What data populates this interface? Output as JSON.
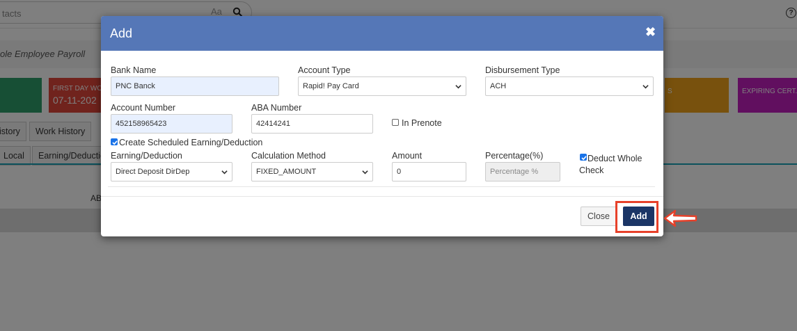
{
  "background": {
    "search": {
      "text": "tacts",
      "aa_label": "Aa"
    },
    "subheader": "ole Employee Payroll",
    "tiles": [
      {
        "label": "",
        "value": ""
      },
      {
        "label": "FIRST DAY WO",
        "value": "07-11-202"
      },
      {
        "label": "S",
        "value": ""
      },
      {
        "label": "EXPIRING CERT.",
        "value": ""
      }
    ],
    "tabs": [
      "istory",
      "Work History"
    ],
    "subtabs": [
      "Local",
      "Earning/Deductio"
    ],
    "column_label": "AB",
    "help": "?"
  },
  "modal": {
    "title": "Add",
    "close_symbol": "✖",
    "bank_name": {
      "label": "Bank Name",
      "value": "PNC Banck"
    },
    "account_type": {
      "label": "Account Type",
      "value": "Rapid! Pay Card"
    },
    "disbursement_type": {
      "label": "Disbursement Type",
      "value": "ACH"
    },
    "account_number": {
      "label": "Account Number",
      "value": "452158965423"
    },
    "aba_number": {
      "label": "ABA Number",
      "value": "42414241"
    },
    "in_prenote": {
      "label": "In Prenote",
      "checked": false
    },
    "create_scheduled": {
      "label": "Create Scheduled Earning/Deduction",
      "checked": true
    },
    "earning_deduction": {
      "label": "Earning/Deduction",
      "value": "Direct Deposit DirDep"
    },
    "calculation_method": {
      "label": "Calculation Method",
      "value": "FIXED_AMOUNT"
    },
    "amount": {
      "label": "Amount",
      "value": "0"
    },
    "percentage": {
      "label": "Percentage(%)",
      "placeholder": "Percentage %"
    },
    "deduct_whole_check": {
      "label_line1": "Deduct Whole",
      "label_line2": "Check",
      "checked": true
    },
    "buttons": {
      "close": "Close",
      "add": "Add"
    }
  },
  "colors": {
    "header_blue": "#5577b7",
    "add_button": "#1b3566",
    "highlight_red": "#e7412a",
    "checkbox_blue": "#1a73e8"
  }
}
